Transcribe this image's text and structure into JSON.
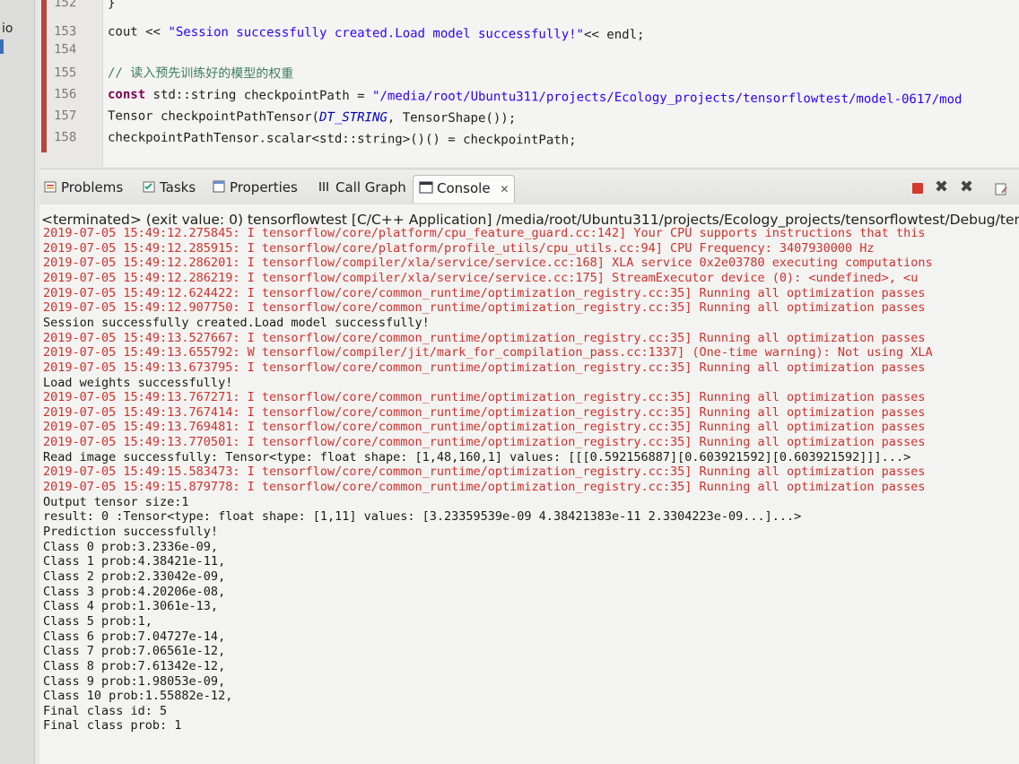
{
  "left_stub": "io",
  "editor": {
    "lines": [
      {
        "num": "152",
        "code": "}"
      },
      {
        "num": "153",
        "code_parts": [
          {
            "t": "cout << ",
            "c": ""
          },
          {
            "t": "\"Session successfully created.Load model successfully!\"",
            "c": "str"
          },
          {
            "t": "<< endl;",
            "c": ""
          }
        ]
      },
      {
        "num": "154",
        "code": ""
      },
      {
        "num": "155",
        "code_parts": [
          {
            "t": "// 读入预先训练好的模型的权重",
            "c": "cm"
          }
        ]
      },
      {
        "num": "156",
        "code_parts": [
          {
            "t": "const",
            "c": "kw"
          },
          {
            "t": " std::string checkpointPath = ",
            "c": ""
          },
          {
            "t": "\"/media/root/Ubuntu311/projects/Ecology_projects/tensorflowtest/model-0617/mod",
            "c": "str"
          }
        ]
      },
      {
        "num": "157",
        "code_parts": [
          {
            "t": "Tensor checkpointPathTensor(",
            "c": ""
          },
          {
            "t": "DT_STRING",
            "c": "ital"
          },
          {
            "t": ", TensorShape());",
            "c": ""
          }
        ]
      },
      {
        "num": "158",
        "code_parts": [
          {
            "t": "checkpointPathTensor.scalar<std::string>()() = checkpointPath;",
            "c": ""
          }
        ]
      }
    ]
  },
  "tabs": [
    {
      "label": "Problems",
      "icon": "problems-icon"
    },
    {
      "label": "Tasks",
      "icon": "tasks-icon"
    },
    {
      "label": "Properties",
      "icon": "properties-icon"
    },
    {
      "label": "Call Graph",
      "icon": "call-graph-icon"
    },
    {
      "label": "Console",
      "icon": "console-icon",
      "active": true
    }
  ],
  "console_header": "<terminated> (exit value: 0) tensorflowtest [C/C++ Application] /media/root/Ubuntu311/projects/Ecology_projects/tensorflowtest/Debug/ten",
  "console_lines": [
    {
      "type": "err",
      "text": "2019-07-05 15:49:12.275845: I tensorflow/core/platform/cpu_feature_guard.cc:142] Your CPU supports instructions that this"
    },
    {
      "type": "err",
      "text": "2019-07-05 15:49:12.285915: I tensorflow/core/platform/profile_utils/cpu_utils.cc:94] CPU Frequency: 3407930000 Hz"
    },
    {
      "type": "err",
      "text": "2019-07-05 15:49:12.286201: I tensorflow/compiler/xla/service/service.cc:168] XLA service 0x2e03780 executing computations"
    },
    {
      "type": "err",
      "text": "2019-07-05 15:49:12.286219: I tensorflow/compiler/xla/service/service.cc:175]   StreamExecutor device (0): <undefined>, <u"
    },
    {
      "type": "err",
      "text": "2019-07-05 15:49:12.624422: I tensorflow/core/common_runtime/optimization_registry.cc:35] Running all optimization passes"
    },
    {
      "type": "err",
      "text": "2019-07-05 15:49:12.907750: I tensorflow/core/common_runtime/optimization_registry.cc:35] Running all optimization passes"
    },
    {
      "type": "out",
      "text": "Session successfully created.Load model successfully!"
    },
    {
      "type": "err",
      "text": "2019-07-05 15:49:13.527667: I tensorflow/core/common_runtime/optimization_registry.cc:35] Running all optimization passes"
    },
    {
      "type": "err",
      "text": "2019-07-05 15:49:13.655792: W tensorflow/compiler/jit/mark_for_compilation_pass.cc:1337] (One-time warning): Not using XLA"
    },
    {
      "type": "err",
      "text": "2019-07-05 15:49:13.673795: I tensorflow/core/common_runtime/optimization_registry.cc:35] Running all optimization passes"
    },
    {
      "type": "out",
      "text": "Load weights successfully!"
    },
    {
      "type": "err",
      "text": "2019-07-05 15:49:13.767271: I tensorflow/core/common_runtime/optimization_registry.cc:35] Running all optimization passes"
    },
    {
      "type": "err",
      "text": "2019-07-05 15:49:13.767414: I tensorflow/core/common_runtime/optimization_registry.cc:35] Running all optimization passes"
    },
    {
      "type": "err",
      "text": "2019-07-05 15:49:13.769481: I tensorflow/core/common_runtime/optimization_registry.cc:35] Running all optimization passes"
    },
    {
      "type": "err",
      "text": "2019-07-05 15:49:13.770501: I tensorflow/core/common_runtime/optimization_registry.cc:35] Running all optimization passes"
    },
    {
      "type": "out",
      "text": "Read image successfully: Tensor<type: float shape: [1,48,160,1] values: [[[0.592156887][0.603921592][0.603921592]]]...>"
    },
    {
      "type": "err",
      "text": "2019-07-05 15:49:15.583473: I tensorflow/core/common_runtime/optimization_registry.cc:35] Running all optimization passes"
    },
    {
      "type": "err",
      "text": "2019-07-05 15:49:15.879778: I tensorflow/core/common_runtime/optimization_registry.cc:35] Running all optimization passes"
    },
    {
      "type": "out",
      "text": "Output tensor size:1"
    },
    {
      "type": "out",
      "text": "result: 0 :Tensor<type: float shape: [1,11] values: [3.23359539e-09 4.38421383e-11 2.3304223e-09...]...>"
    },
    {
      "type": "out",
      "text": "Prediction successfully!"
    },
    {
      "type": "out",
      "text": "Class 0 prob:3.2336e-09,"
    },
    {
      "type": "out",
      "text": "Class 1 prob:4.38421e-11,"
    },
    {
      "type": "out",
      "text": "Class 2 prob:2.33042e-09,"
    },
    {
      "type": "out",
      "text": "Class 3 prob:4.20206e-08,"
    },
    {
      "type": "out",
      "text": "Class 4 prob:1.3061e-13,"
    },
    {
      "type": "out",
      "text": "Class 5 prob:1,"
    },
    {
      "type": "out",
      "text": "Class 6 prob:7.04727e-14,"
    },
    {
      "type": "out",
      "text": "Class 7 prob:7.06561e-12,"
    },
    {
      "type": "out",
      "text": "Class 8 prob:7.61342e-12,"
    },
    {
      "type": "out",
      "text": "Class 9 prob:1.98053e-09,"
    },
    {
      "type": "out",
      "text": "Class 10 prob:1.55882e-12,"
    },
    {
      "type": "out",
      "text": "Final class id: 5"
    },
    {
      "type": "out",
      "text": "Final class prob: 1"
    }
  ],
  "colors": {
    "error_text": "#d2302c",
    "stdout_text": "#1a1a1a",
    "terminate_red": "#d33a2c"
  }
}
